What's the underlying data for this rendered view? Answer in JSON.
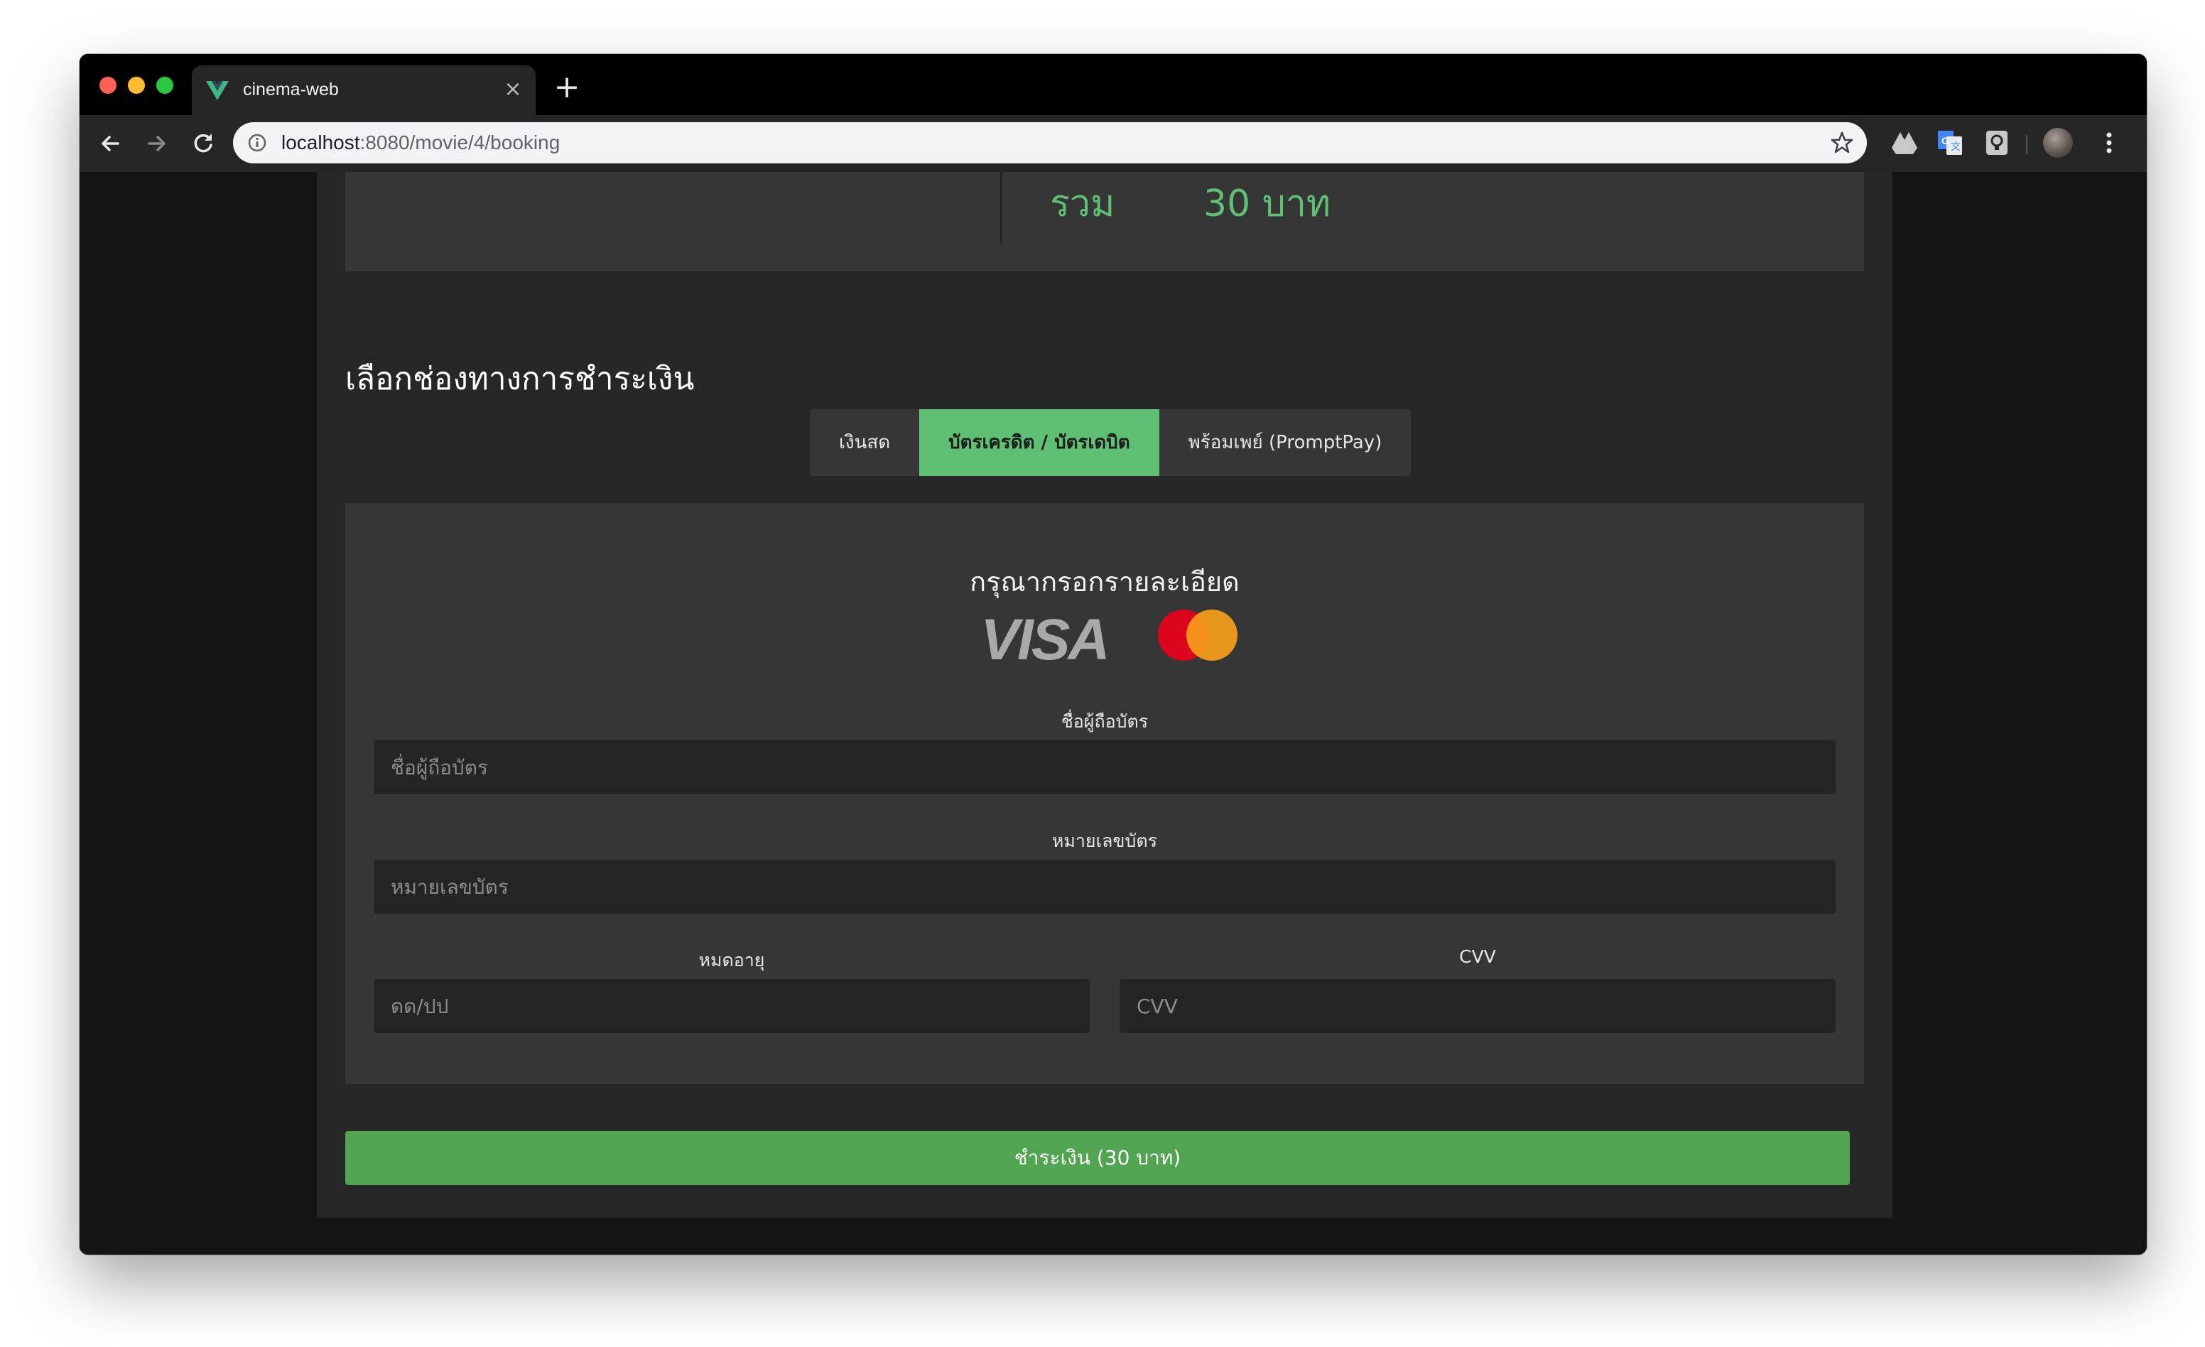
{
  "browser": {
    "tab_title": "cinema-web",
    "url_host": "localhost",
    "url_rest": ":8080/movie/4/booking"
  },
  "summary": {
    "total_label": "รวม",
    "total_value": "30 บาท"
  },
  "payment": {
    "section_title": "เลือกช่องทางการชำระเงิน",
    "tabs": [
      {
        "label": "เงินสด",
        "active": false
      },
      {
        "label": "บัตรเครดิต / บัตรเดบิต",
        "active": true
      },
      {
        "label": "พร้อมเพย์ (PromptPay)",
        "active": false
      }
    ]
  },
  "card_form": {
    "title": "กรุณากรอกรายละเอียด",
    "holder": {
      "label": "ชื่อผู้ถือบัตร",
      "placeholder": "ชื่อผู้ถือบัตร",
      "value": ""
    },
    "number": {
      "label": "หมายเลขบัตร",
      "placeholder": "หมายเลขบัตร",
      "value": ""
    },
    "expiry": {
      "label": "หมดอายุ",
      "placeholder": "ดด/ปป",
      "value": ""
    },
    "cvv": {
      "label": "CVV",
      "placeholder": "CVV",
      "value": ""
    },
    "logos": {
      "visa": "VISA"
    }
  },
  "pay_button": "ชำระเงิน (30 บาท)",
  "colors": {
    "accent_green": "#5fbf73",
    "button_green": "#52a550",
    "page_bg": "#272727",
    "panel_bg": "#363636",
    "input_bg": "#252525"
  },
  "icons": [
    "vue-favicon-icon",
    "close-icon",
    "plus-icon",
    "arrow-left-icon",
    "arrow-right-icon",
    "reload-icon",
    "info-icon",
    "star-icon",
    "drive-icon",
    "translate-icon",
    "keep-icon",
    "avatar",
    "kebab-menu-icon"
  ]
}
